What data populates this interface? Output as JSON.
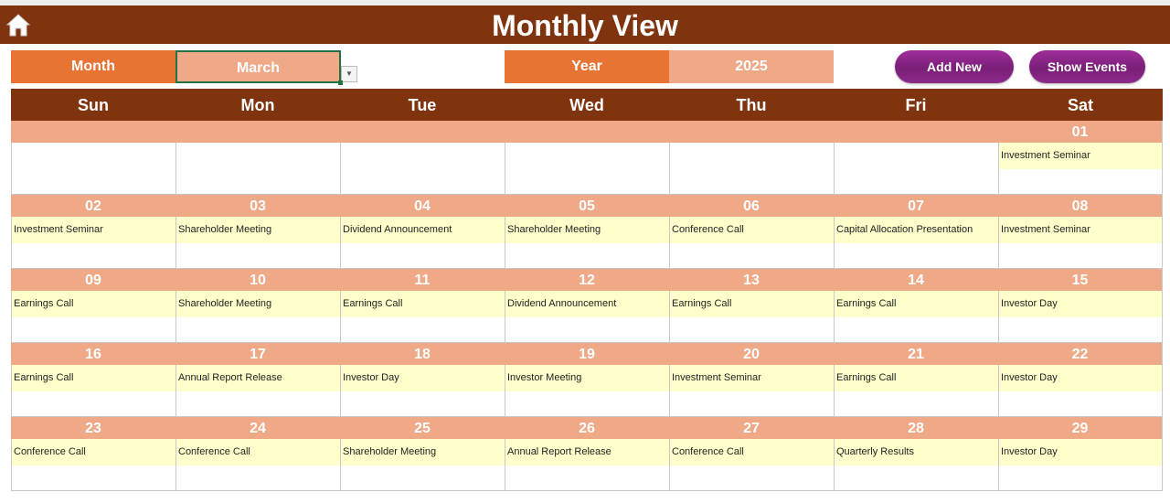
{
  "header": {
    "title": "Monthly View",
    "home_icon": "home-icon"
  },
  "controls": {
    "month_label": "Month",
    "month_value": "March",
    "year_label": "Year",
    "year_value": "2025",
    "add_new": "Add New",
    "show_events": "Show Events"
  },
  "colors": {
    "header": "#7f340f",
    "label": "#e87434",
    "value": "#f0a987",
    "event": "#ffffcc",
    "button": "#8d2a8a"
  },
  "weekdays": [
    "Sun",
    "Mon",
    "Tue",
    "Wed",
    "Thu",
    "Fri",
    "Sat"
  ],
  "weeks": [
    [
      {
        "day": "",
        "event": ""
      },
      {
        "day": "",
        "event": ""
      },
      {
        "day": "",
        "event": ""
      },
      {
        "day": "",
        "event": ""
      },
      {
        "day": "",
        "event": ""
      },
      {
        "day": "",
        "event": ""
      },
      {
        "day": "01",
        "event": "Investment Seminar"
      }
    ],
    [
      {
        "day": "02",
        "event": "Investment Seminar"
      },
      {
        "day": "03",
        "event": "Shareholder Meeting"
      },
      {
        "day": "04",
        "event": "Dividend Announcement"
      },
      {
        "day": "05",
        "event": "Shareholder Meeting"
      },
      {
        "day": "06",
        "event": "Conference Call"
      },
      {
        "day": "07",
        "event": "Capital Allocation Presentation"
      },
      {
        "day": "08",
        "event": "Investment Seminar"
      }
    ],
    [
      {
        "day": "09",
        "event": "Earnings Call"
      },
      {
        "day": "10",
        "event": "Shareholder Meeting"
      },
      {
        "day": "11",
        "event": "Earnings Call"
      },
      {
        "day": "12",
        "event": "Dividend Announcement"
      },
      {
        "day": "13",
        "event": "Earnings Call"
      },
      {
        "day": "14",
        "event": "Earnings Call"
      },
      {
        "day": "15",
        "event": "Investor Day"
      }
    ],
    [
      {
        "day": "16",
        "event": "Earnings Call"
      },
      {
        "day": "17",
        "event": "Annual Report Release"
      },
      {
        "day": "18",
        "event": "Investor Day"
      },
      {
        "day": "19",
        "event": "Investor Meeting"
      },
      {
        "day": "20",
        "event": "Investment Seminar"
      },
      {
        "day": "21",
        "event": "Earnings Call"
      },
      {
        "day": "22",
        "event": "Investor Day"
      }
    ],
    [
      {
        "day": "23",
        "event": "Conference Call"
      },
      {
        "day": "24",
        "event": "Conference Call"
      },
      {
        "day": "25",
        "event": "Shareholder Meeting"
      },
      {
        "day": "26",
        "event": "Annual Report Release"
      },
      {
        "day": "27",
        "event": "Conference Call"
      },
      {
        "day": "28",
        "event": "Quarterly Results"
      },
      {
        "day": "29",
        "event": "Investor Day"
      }
    ]
  ]
}
